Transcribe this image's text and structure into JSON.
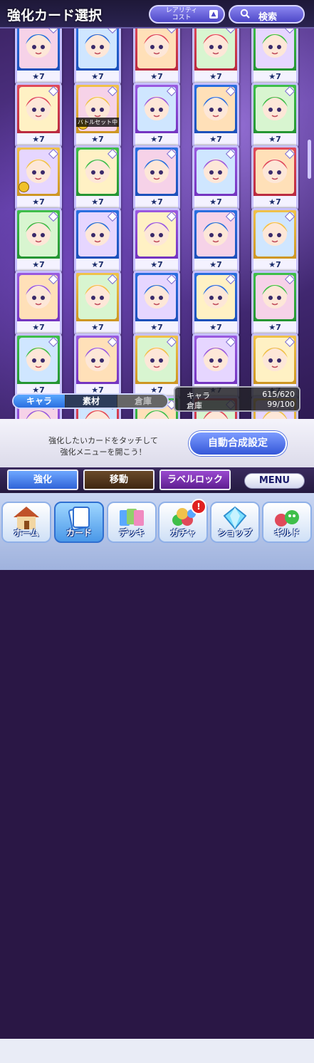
{
  "header": {
    "title": "強化カード選択",
    "sort_label": "レアリティ\nコスト",
    "search_label": "検索"
  },
  "cards": [
    {
      "rarity": "★7",
      "frame": "blue"
    },
    {
      "rarity": "★7",
      "frame": "blue"
    },
    {
      "rarity": "★7",
      "frame": "red"
    },
    {
      "rarity": "★7",
      "frame": "red"
    },
    {
      "rarity": "★7",
      "frame": "green"
    },
    {
      "rarity": "★7",
      "frame": "red"
    },
    {
      "rarity": "★7",
      "frame": "yellow",
      "tag": "バトルセット中"
    },
    {
      "rarity": "★7",
      "frame": "purple"
    },
    {
      "rarity": "★7",
      "frame": "blue"
    },
    {
      "rarity": "★7",
      "frame": "green"
    },
    {
      "rarity": "★7",
      "frame": "yellow"
    },
    {
      "rarity": "★7",
      "frame": "green"
    },
    {
      "rarity": "★7",
      "frame": "blue"
    },
    {
      "rarity": "★7",
      "frame": "purple"
    },
    {
      "rarity": "★7",
      "frame": "red"
    },
    {
      "rarity": "★7",
      "frame": "green"
    },
    {
      "rarity": "★7",
      "frame": "blue"
    },
    {
      "rarity": "★7",
      "frame": "purple"
    },
    {
      "rarity": "★7",
      "frame": "blue"
    },
    {
      "rarity": "★7",
      "frame": "yellow"
    },
    {
      "rarity": "★7",
      "frame": "purple"
    },
    {
      "rarity": "★7",
      "frame": "yellow"
    },
    {
      "rarity": "★7",
      "frame": "blue"
    },
    {
      "rarity": "★7",
      "frame": "blue"
    },
    {
      "rarity": "★7",
      "frame": "green"
    },
    {
      "rarity": "★7",
      "frame": "green"
    },
    {
      "rarity": "★7",
      "frame": "purple"
    },
    {
      "rarity": "★7",
      "frame": "yellow"
    },
    {
      "rarity": "★7",
      "frame": "purple"
    },
    {
      "rarity": "★7",
      "frame": "yellow"
    },
    {
      "rarity": "★7",
      "frame": "purple"
    },
    {
      "rarity": "★7",
      "frame": "red"
    },
    {
      "rarity": "★7",
      "frame": "green"
    },
    {
      "rarity": "★7",
      "frame": "red"
    },
    {
      "rarity": "★7",
      "frame": "yellow"
    },
    {
      "rarity": "",
      "frame": "green"
    },
    {
      "rarity": "",
      "frame": "red"
    },
    {
      "rarity": "",
      "frame": "purple"
    },
    {
      "rarity": "",
      "frame": "yellow"
    },
    {
      "rarity": "",
      "frame": "green"
    }
  ],
  "tabs": {
    "chara": "キャラ",
    "material": "素材",
    "storage": "倉庫"
  },
  "info": {
    "chara_label": "キャラ",
    "chara_value": "615/620",
    "storage_label": "倉庫",
    "storage_value": "99/100"
  },
  "message": {
    "line1": "強化したいカードをタッチして",
    "line2": "強化メニューを開こう！",
    "auto_button": "自動合成設定"
  },
  "modes": {
    "enhance": "強化",
    "move": "移動",
    "label_lock": "ラベルロック",
    "menu": "MENU"
  },
  "nav": {
    "home": "ホーム",
    "card": "カード",
    "deck": "デッキ",
    "gacha": "ガチャ",
    "gacha_badge": "!",
    "shop": "ショップ",
    "guild": "ギルド"
  },
  "colors": {
    "blue": "#2a6fe0",
    "red": "#e04a5a",
    "green": "#3fbf4a",
    "purple": "#9a5ae0",
    "yellow": "#f0c24a"
  }
}
